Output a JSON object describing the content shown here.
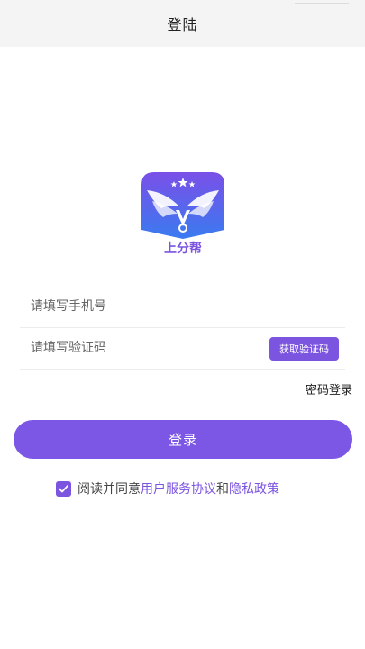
{
  "header": {
    "title": "登陆"
  },
  "logo": {
    "text": "上分帮",
    "accent_color": "#7b54e0"
  },
  "form": {
    "phone_placeholder": "请填写手机号",
    "code_placeholder": "请填写验证码",
    "code_button_label": "获取验证码",
    "password_login_label": "密码登录",
    "login_button_label": "登录"
  },
  "agreement": {
    "checked": true,
    "prefix": "阅读并同意",
    "terms_link": "用户服务协议",
    "and": "和",
    "privacy_link": "隐私政策"
  },
  "icons": {
    "checkbox": "checkmark-icon"
  },
  "colors": {
    "primary": "#7b54e0",
    "header_bg": "#f4f4f4"
  }
}
